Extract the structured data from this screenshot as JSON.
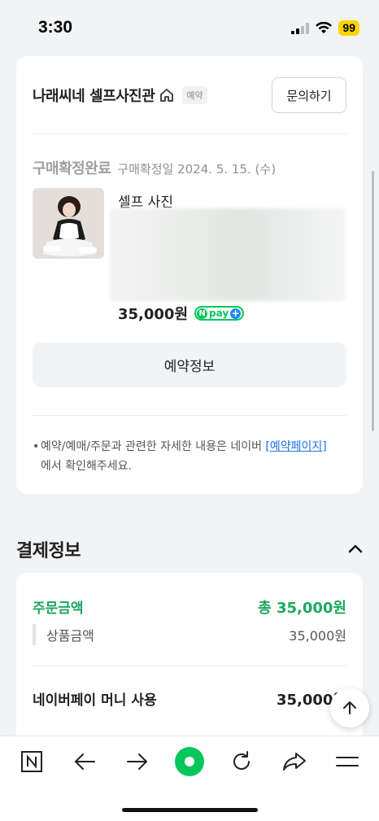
{
  "status_bar": {
    "time": "3:30",
    "battery": "99"
  },
  "store": {
    "name": "나래씨네 셀프사진관",
    "badge": "예약",
    "inquiry_button": "문의하기",
    "status_label": "구매확정완료",
    "status_date": "구매확정일 2024. 5. 15. (수)",
    "product_name": "셀프 사진",
    "price": "35,000원",
    "npay_text": "pay",
    "reserve_info_button": "예약정보",
    "notice_text": "예약/예매/주문과 관련한 자세한 내용은 네이버 ",
    "notice_link": "[예약페이지]",
    "notice_text_end": "에서 확인해주세요."
  },
  "payment": {
    "section_title": "결제정보",
    "order_label": "주문금액",
    "order_total": "총 35,000원",
    "sub_label": "상품금액",
    "sub_value": "35,000원",
    "money_label": "네이버페이 머니 사용",
    "money_value": "35,000원"
  },
  "colors": {
    "accent_green": "#1ca760",
    "npay_green": "#03c75a",
    "battery_yellow": "#ffd400"
  },
  "icons": [
    "home-icon",
    "naver-n-icon",
    "back-arrow-icon",
    "forward-arrow-icon",
    "green-home-dot-icon",
    "refresh-icon",
    "share-icon",
    "menu-icon",
    "chevron-up-icon",
    "arrow-up-icon"
  ]
}
